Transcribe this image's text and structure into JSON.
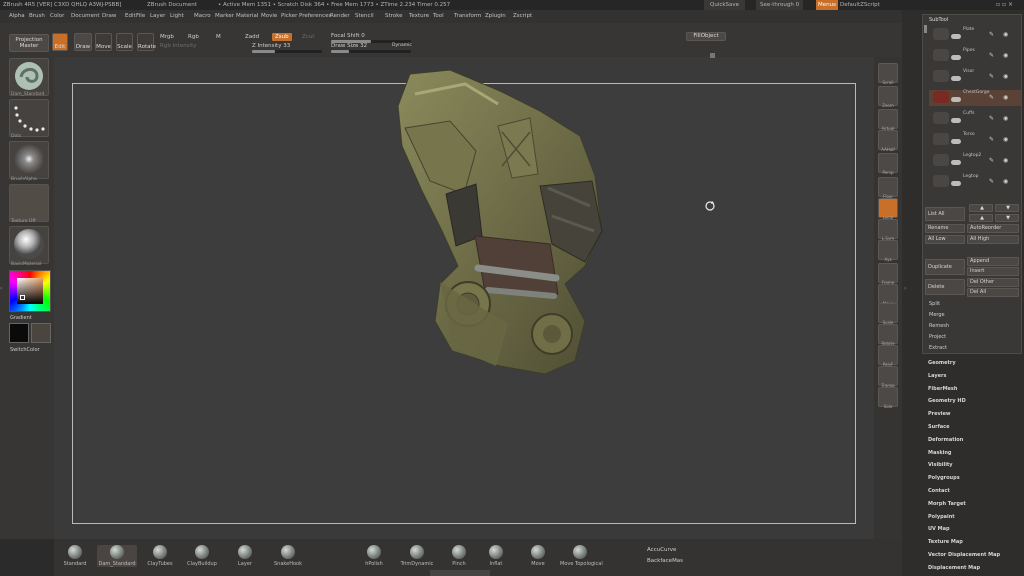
{
  "titlebar": {
    "app": "ZBrush 4R5 [VER] C3XD QHLQ A3WJ-PSBB]",
    "doc": "ZBrush Document",
    "stats": "• Active Mem 1351 • Scratch Disk 364 • Free Mem 1773 • ZTime 2.234 Timer 0.257",
    "quicksave": "QuickSave",
    "seethrough": "See-through 0",
    "menus": "Menus",
    "script": "DefaultZScript"
  },
  "menubar": [
    "Alpha",
    "Brush",
    "Color",
    "Document",
    "Draw",
    "Edit",
    "File",
    "Layer",
    "Light",
    "Macro",
    "Marker",
    "Material",
    "Movie",
    "Picker",
    "Preferences",
    "Render",
    "Stencil",
    "Stroke",
    "Texture",
    "Tool",
    "Transform",
    "Zplugin",
    "Zscript"
  ],
  "toolbar": {
    "projection_master": "Projection Master",
    "edit": "Edit",
    "draw": "Draw",
    "move": "Move",
    "scale": "Scale",
    "rotate": "Rotate",
    "mrgb": "Mrgb",
    "rgb": "Rgb",
    "m": "M",
    "rgb_intensity": "Rgb Intensity",
    "zadd": "Zadd",
    "zsub": "Zsub",
    "zcut": "Zcut",
    "z_intensity": "Z Intensity 33",
    "focal_shift": "Focal Shift 0",
    "draw_size": "Draw Size 32",
    "dynamic": "Dynamic",
    "fill_object": "FillObject"
  },
  "leftshelf": {
    "brush_label": "Dam_Standard",
    "stroke_label": "Dots",
    "alpha_label": "BrushAlpha",
    "texture_label": "Texture Off",
    "material_label": "BasicMaterial",
    "gradient_label": "Gradient",
    "switch_label": "SwitchColor"
  },
  "rightshelf": [
    "Scroll",
    "Zoom",
    "Actual",
    "AAHalf",
    "Persp",
    "Floor",
    "Local",
    "L.Sym",
    "Xyz",
    "Frame",
    "Move",
    "Scale",
    "Rotate",
    "PolyF",
    "Transp",
    "Solo"
  ],
  "subtool": {
    "header": "SubTool",
    "items": [
      {
        "name": "Plate"
      },
      {
        "name": "Pipes"
      },
      {
        "name": "Visor"
      },
      {
        "name": "ChestGorge"
      },
      {
        "name": "Cuffs"
      },
      {
        "name": "Torso"
      },
      {
        "name": "Legtop2"
      },
      {
        "name": "Legtop"
      }
    ],
    "list_all": "List All",
    "rename": "Rename",
    "auto_reorder": "AutoReorder",
    "all_low": "All Low",
    "all_high": "All High",
    "duplicate": "Duplicate",
    "append": "Append",
    "insert": "Insert",
    "delete": "Delete",
    "del_other": "Del Other",
    "del_all": "Del All",
    "split": "Split",
    "merge": "Merge",
    "remesh": "Remesh",
    "project": "Project",
    "extract": "Extract"
  },
  "tool_menus": [
    "Geometry",
    "Layers",
    "FiberMesh",
    "Geometry HD",
    "Preview",
    "Surface",
    "Deformation",
    "Masking",
    "Visibility",
    "Polygroups",
    "Contact",
    "Morph Target",
    "Polypaint",
    "UV Map",
    "Texture Map",
    "Vector Displacement Map",
    "Displacement Map"
  ],
  "brushes": [
    "Standard",
    "Dam_Standard",
    "ClayTubes",
    "ClayBuildup",
    "Layer",
    "SnakeHook",
    "hPolish",
    "TrimDynamic",
    "Pinch",
    "Inflat",
    "Move",
    "Move Topological"
  ],
  "bottom_right": {
    "accucurve": "AccuCurve",
    "backface": "BackfaceMas"
  },
  "colors": {
    "accent_orange": "#c8702a",
    "model_green": "#6b6b45",
    "canvas_border": "#b9b9b9"
  }
}
